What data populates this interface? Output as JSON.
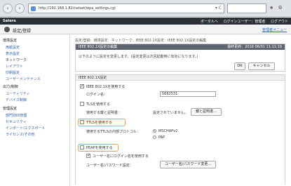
{
  "browser": {
    "address": "http://192.168.1.82/netset/wpa_settings.cgi",
    "tools": "▾ C",
    "back_glyph": "‹",
    "forward_glyph": "›",
    "toolbar_icons": "★ ⚙"
  },
  "app": {
    "brand": "Satera",
    "header_links": [
      "ポータルへ",
      "ログインユーザー：管理者",
      "ログアウト"
    ]
  },
  "titlebar": {
    "title": "設定/登録",
    "portal_link": "管理者メニュー"
  },
  "sidebar": {
    "sections": [
      {
        "label": "環境設定",
        "items": [
          "用紙設定",
          "表示設定",
          "ネットワーク",
          "レイアウト",
          "印刷設定",
          "ユーザーメンテナンス"
        ]
      },
      {
        "label": "出力/制御",
        "items": [
          "ユーティリティ",
          "デバイス制御"
        ]
      },
      {
        "label": "管理設定",
        "items": [
          "部門別ID管理",
          "セキュリティ",
          "インポート/エクスポート",
          "ライセンス/その他"
        ]
      }
    ]
  },
  "main": {
    "breadcrumb": "設定/登録：環境設定：ネットワーク：IEEE 802.1X設定：IEEE 802.1X設定の編集",
    "edit_panel": {
      "title": "IEEE 802.1X設定の編集",
      "last_updated": "最終更新：2016 06/01 11:11:19",
      "message": "以下のように設定を変更します。(設定変更は次回起動時に有効になります。)",
      "ok_label": "OK",
      "cancel_label": "キャンセル"
    },
    "settings_panel": {
      "section_title": "IEEE 802.1X設定",
      "use_8021x_label": "IEEE 802.1Xを使用する",
      "use_8021x_checked": true,
      "login_name_label": "ログイン名：",
      "login_name_value": "5682531",
      "tls_label": "TLSを使用する",
      "tls_checked": false,
      "key_cert_label": "使用する鍵と証明書：",
      "key_cert_value": "設定されていません。",
      "key_cert_button": "鍵と証明書...",
      "ttls_label": "TTLSを使用する",
      "ttls_checked": false,
      "ttls_protocol_label": "使用するTTLSの内部プロトコル：",
      "ttls_protocols": [
        {
          "label": "MSCHAPv2",
          "selected": true
        },
        {
          "label": "PAP",
          "selected": false
        }
      ],
      "peap_label": "PEAPを使用する",
      "peap_checked": false,
      "user_name_label": "ユーザー名にログイン名を使用する",
      "user_name_checked": true,
      "user_pass_label": "ユーザー名/パスワード設定：",
      "user_pass_button": "ユーザー名/パスワード変更..."
    }
  },
  "colors": {
    "link": "#2b62b0",
    "highlight": "#f0a040",
    "panel_head": "#5d6570",
    "app_header": "#2b2f36"
  }
}
